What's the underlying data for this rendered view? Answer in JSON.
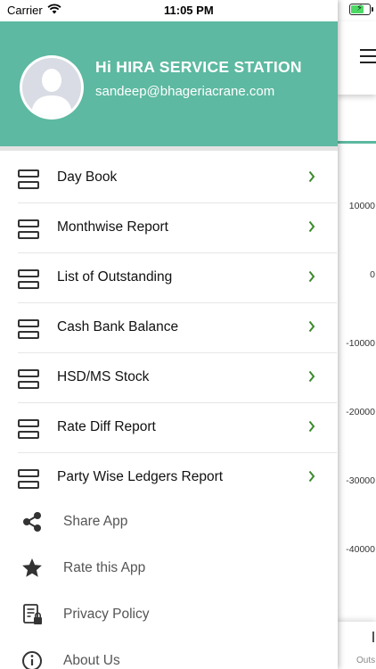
{
  "status_bar": {
    "carrier": "Carrier",
    "time": "11:05 PM"
  },
  "profile": {
    "name": "Hi HIRA SERVICE STATION",
    "email": "sandeep@bhageriacrane.com"
  },
  "colors": {
    "header_bg": "#5db9a1",
    "chevron": "#3b8a2b",
    "icon": "#333333"
  },
  "menu": {
    "items": [
      {
        "label": "Day Book",
        "icon": "stack-icon"
      },
      {
        "label": "Monthwise Report",
        "icon": "stack-icon"
      },
      {
        "label": "List of Outstanding",
        "icon": "stack-icon"
      },
      {
        "label": "Cash Bank Balance",
        "icon": "stack-icon"
      },
      {
        "label": "HSD/MS Stock",
        "icon": "stack-icon"
      },
      {
        "label": "Rate Diff Report",
        "icon": "stack-icon"
      },
      {
        "label": "Party Wise Ledgers Report",
        "icon": "stack-icon"
      }
    ],
    "extra": [
      {
        "label": "Share App",
        "icon": "share-icon"
      },
      {
        "label": "Rate this App",
        "icon": "star-icon"
      },
      {
        "label": "Privacy Policy",
        "icon": "privacy-icon"
      },
      {
        "label": "About Us",
        "icon": "info-icon"
      }
    ]
  },
  "background_chart": {
    "y_ticks": [
      "10000",
      "0",
      "-10000",
      "-20000",
      "-30000",
      "-40000"
    ],
    "bottom_label": "Outs"
  }
}
